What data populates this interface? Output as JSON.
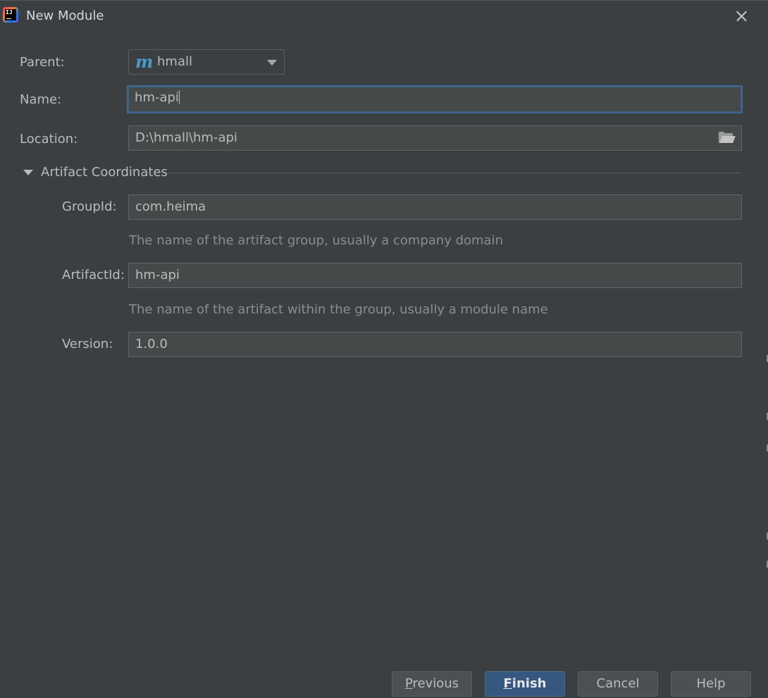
{
  "window": {
    "title": "New Module",
    "app_icon": "intellij-icon",
    "app_icon_text": "IJ"
  },
  "form": {
    "parent_label": "Parent:",
    "parent_value": "hmall",
    "parent_icon": "maven-icon",
    "parent_icon_glyph": "m",
    "name_label": "Name:",
    "name_value": "hm-api",
    "location_label": "Location:",
    "location_value": "D:\\hmall\\hm-api"
  },
  "artifact": {
    "section_title": "Artifact Coordinates",
    "expanded": true,
    "groupid_label": "GroupId:",
    "groupid_value": "com.heima",
    "groupid_hint": "The name of the artifact group, usually a company domain",
    "artifactid_label": "ArtifactId:",
    "artifactid_value": "hm-api",
    "artifactid_hint": "The name of the artifact within the group, usually a module name",
    "version_label": "Version:",
    "version_value": "1.0.0"
  },
  "buttons": {
    "previous_mnemonic": "P",
    "previous_rest": "revious",
    "finish_mnemonic": "F",
    "finish_rest": "inish",
    "cancel": "Cancel",
    "help": "Help"
  },
  "colors": {
    "background": "#3c3f41",
    "field": "#45494a",
    "focus_border": "#3d6185",
    "primary_button": "#365880",
    "maven_blue": "#4a9bc9"
  }
}
